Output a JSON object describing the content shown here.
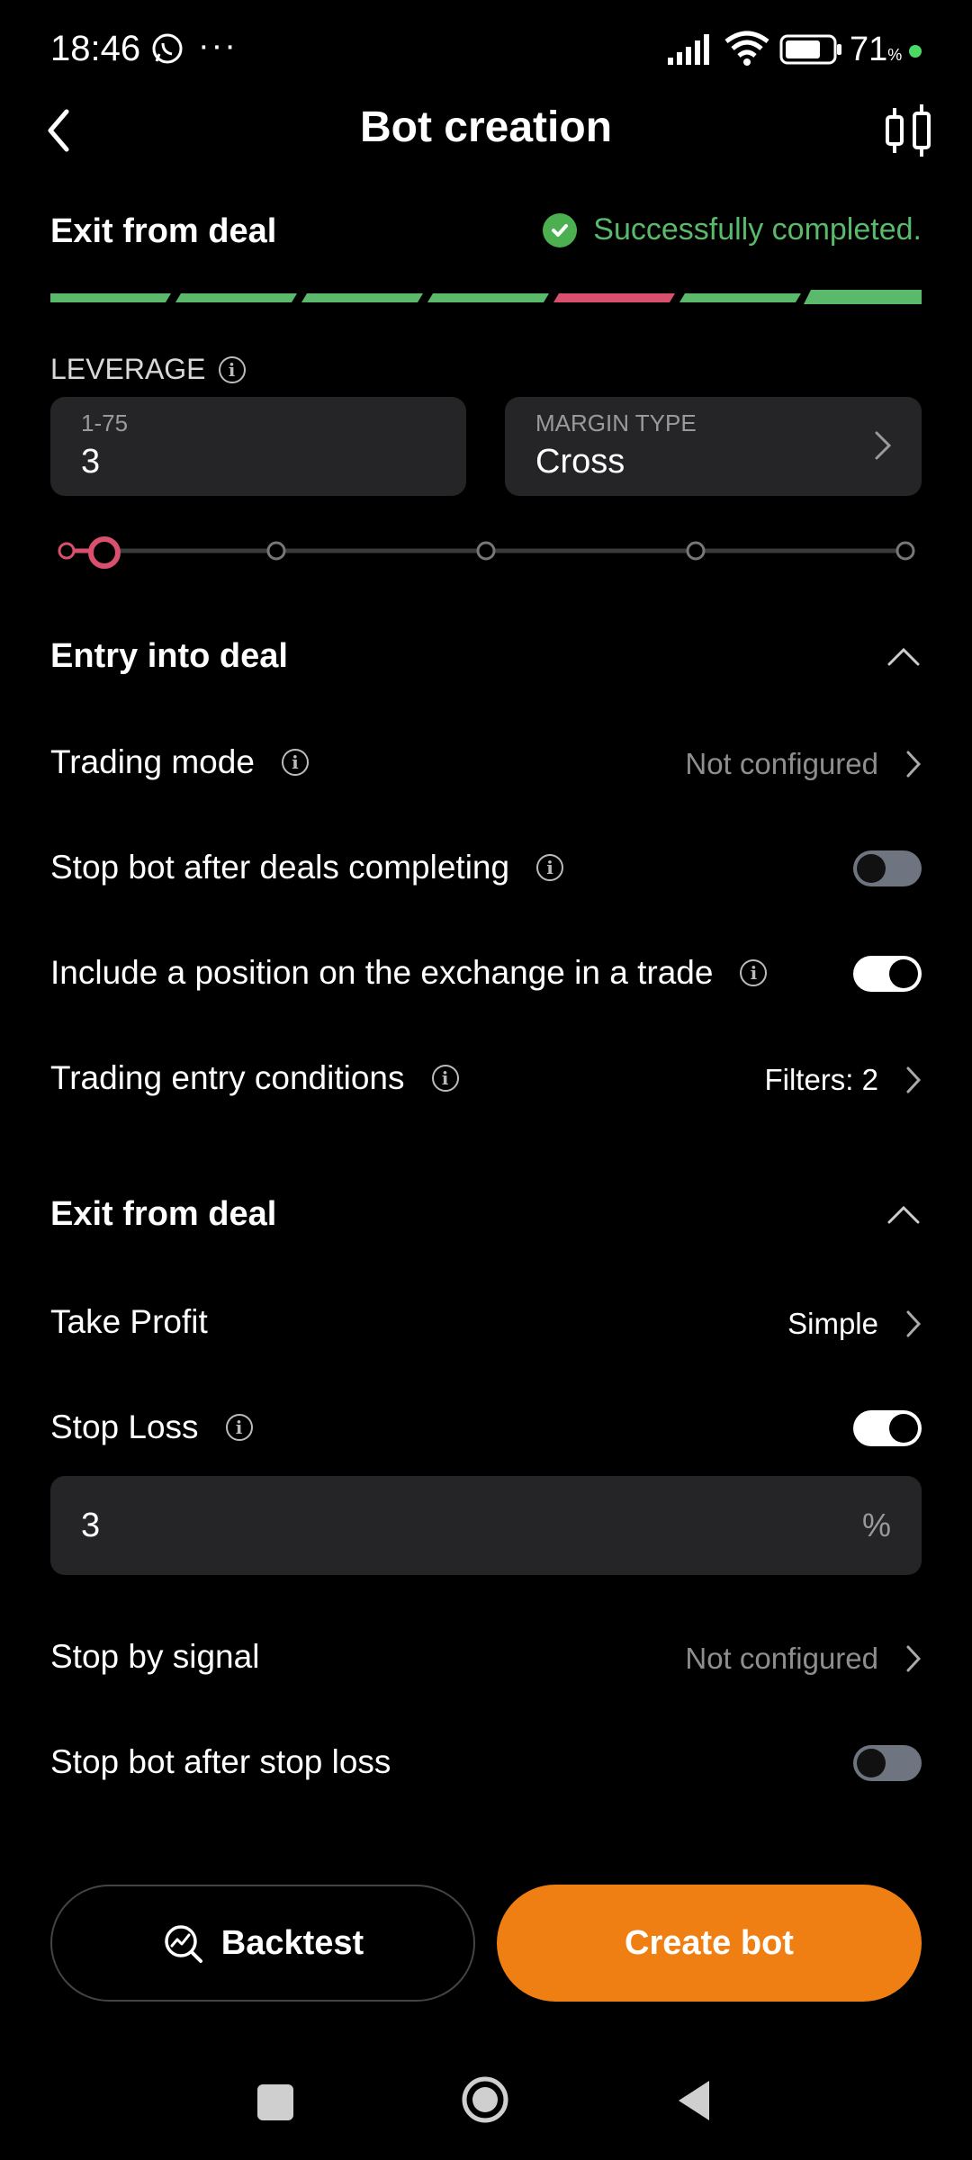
{
  "status_bar": {
    "time": "18:46",
    "battery": "71",
    "battery_unit": "%"
  },
  "header": {
    "title": "Bot creation"
  },
  "step": {
    "title": "Exit from deal",
    "status": "Successfully completed."
  },
  "leverage": {
    "label": "LEVERAGE",
    "range_caption": "1-75",
    "value": "3",
    "margin_caption": "MARGIN TYPE",
    "margin_value": "Cross",
    "slider_fraction": 0.03
  },
  "entry": {
    "title": "Entry into deal",
    "trading_mode_label": "Trading mode",
    "trading_mode_value": "Not configured",
    "stop_after_deals_label": "Stop bot after deals completing",
    "stop_after_deals_on": false,
    "include_position_label": "Include a position on the exchange in a trade",
    "include_position_on": true,
    "conditions_label": "Trading entry conditions",
    "conditions_value": "Filters: 2"
  },
  "exit": {
    "title": "Exit from deal",
    "take_profit_label": "Take Profit",
    "take_profit_value": "Simple",
    "stop_loss_label": "Stop Loss",
    "stop_loss_on": true,
    "stop_loss_value": "3",
    "stop_loss_unit": "%",
    "stop_signal_label": "Stop by signal",
    "stop_signal_value": "Not configured",
    "stop_after_sl_label": "Stop bot after stop loss",
    "stop_after_sl_on": false
  },
  "actions": {
    "backtest_label": "Backtest",
    "create_label": "Create bot"
  },
  "colors": {
    "accent": "#ef7f13",
    "success": "#5ab96b",
    "error_step": "#d9506f",
    "background": "#000000"
  }
}
